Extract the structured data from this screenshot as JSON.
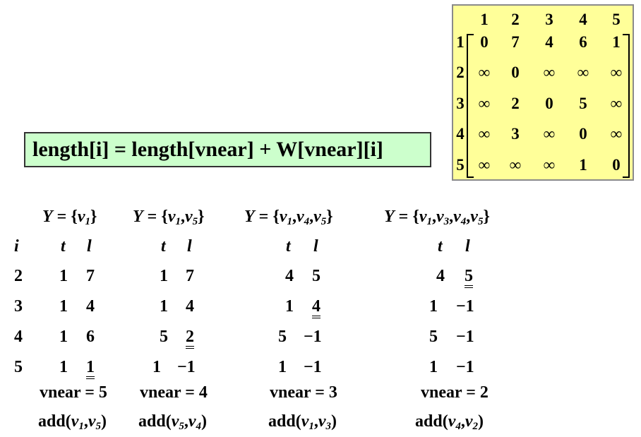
{
  "matrix": {
    "col_headers": [
      "1",
      "2",
      "3",
      "4",
      "5"
    ],
    "row_headers": [
      "1",
      "2",
      "3",
      "4",
      "5"
    ],
    "rows": [
      [
        "0",
        "7",
        "4",
        "6",
        "1"
      ],
      [
        "∞",
        "0",
        "∞",
        "∞",
        "∞"
      ],
      [
        "∞",
        "2",
        "0",
        "5",
        "∞"
      ],
      [
        "∞",
        "3",
        "∞",
        "0",
        "∞"
      ],
      [
        "∞",
        "∞",
        "∞",
        "1",
        "0"
      ]
    ]
  },
  "formula": "length[i] = length[vnear] + W[vnear][i]",
  "table": {
    "y_sets": [
      "Y = {v1}",
      "Y = {v1,v5}",
      "Y = {v1,v4,v5}",
      "Y = {v1,v3,v4,v5}"
    ],
    "i_header": "i",
    "t_header": "t",
    "l_header": "l",
    "rows": [
      {
        "i": "2",
        "cells": [
          [
            "1",
            "7"
          ],
          [
            "1",
            "7"
          ],
          [
            "4",
            "5"
          ],
          [
            "4",
            "5"
          ]
        ]
      },
      {
        "i": "3",
        "cells": [
          [
            "1",
            "4"
          ],
          [
            "1",
            "4"
          ],
          [
            "1",
            "4"
          ],
          [
            "1",
            "−1"
          ]
        ]
      },
      {
        "i": "4",
        "cells": [
          [
            "1",
            "6"
          ],
          [
            "5",
            "2"
          ],
          [
            "5",
            "−1"
          ],
          [
            "5",
            "−1"
          ]
        ]
      },
      {
        "i": "5",
        "cells": [
          [
            "1",
            "1"
          ],
          [
            "1",
            "−1"
          ],
          [
            "1",
            "−1"
          ],
          [
            "1",
            "−1"
          ]
        ]
      }
    ],
    "vnear": [
      "vnear = 5",
      "vnear = 4",
      "vnear = 3",
      "vnear = 2"
    ],
    "add": [
      "add(v1,v5)",
      "add(v5,v4)",
      "add(v1,v3)",
      "add(v4,v2)"
    ]
  }
}
